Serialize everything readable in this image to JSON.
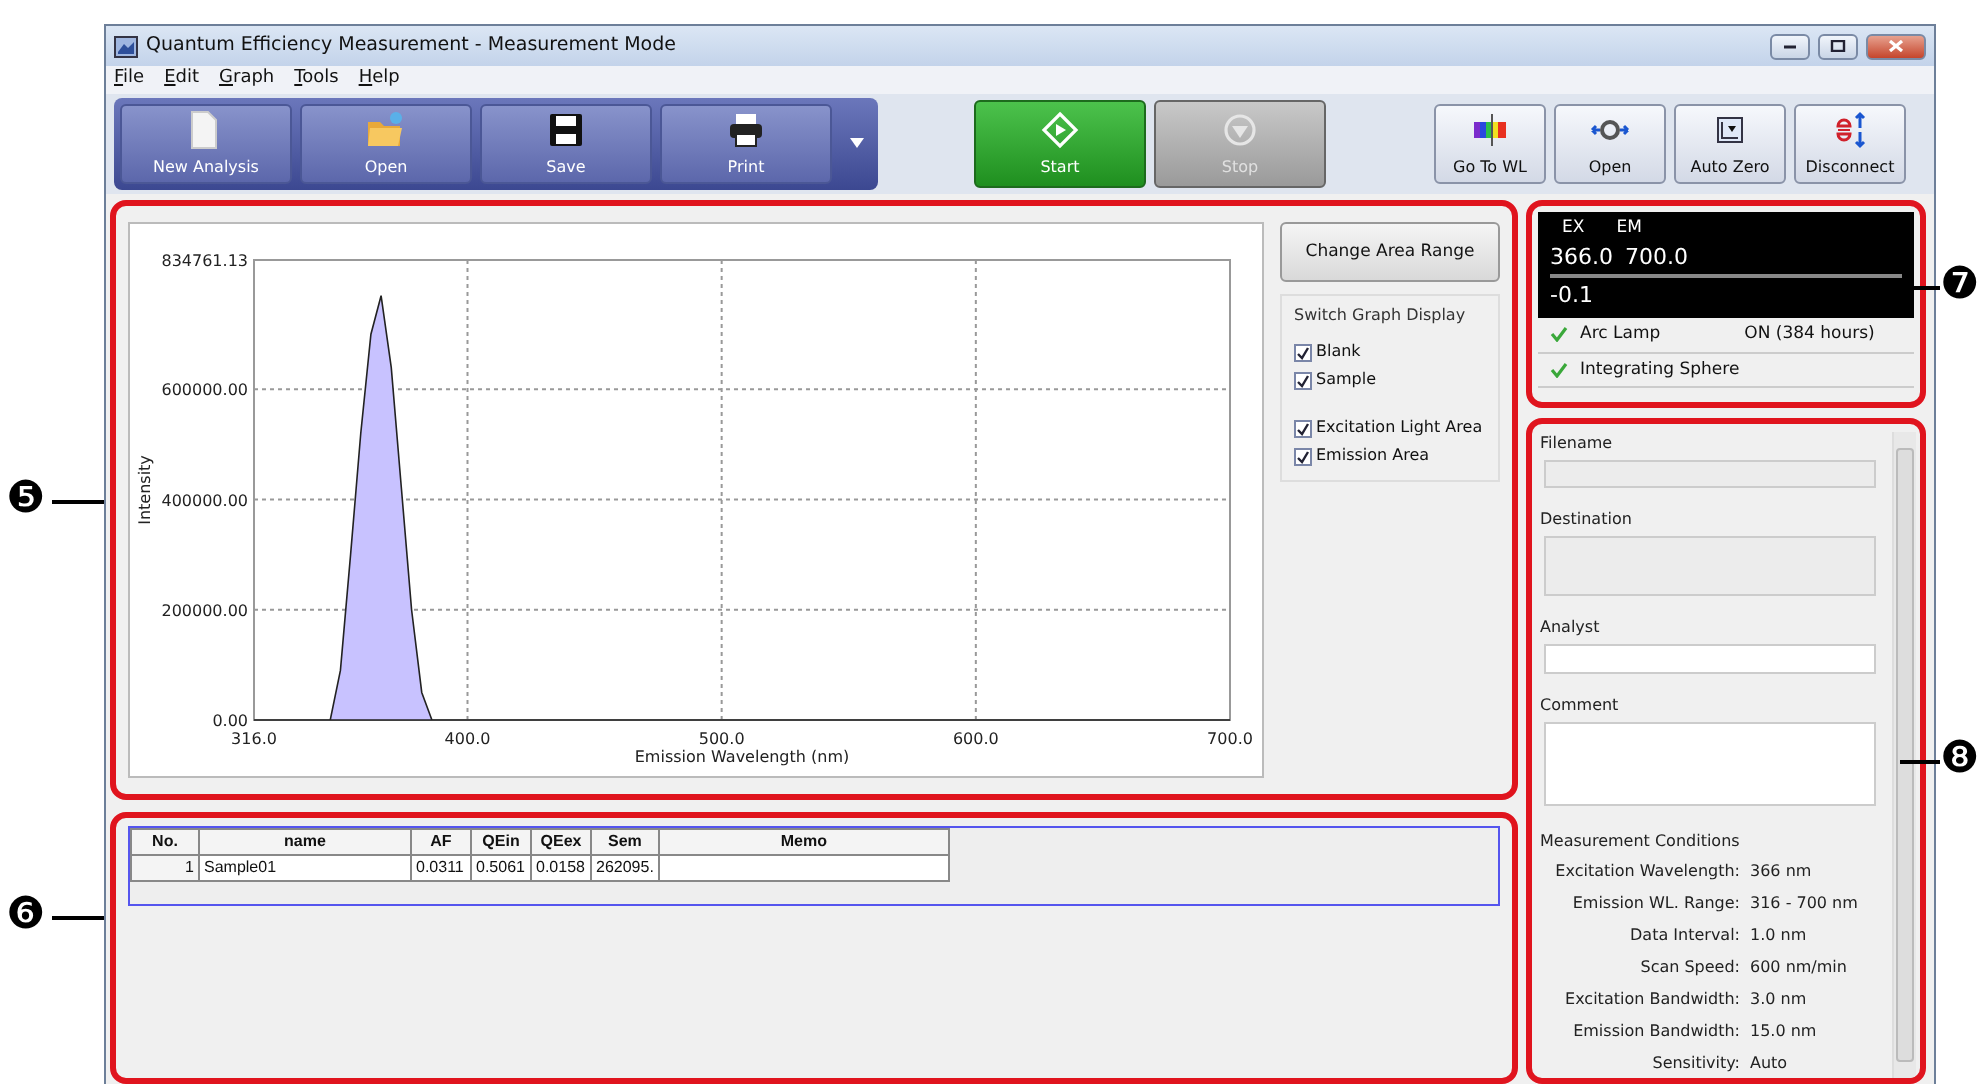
{
  "window": {
    "title": "Quantum Efficiency Measurement - Measurement Mode"
  },
  "menu": [
    "File",
    "Edit",
    "Graph",
    "Tools",
    "Help"
  ],
  "toolbar": {
    "file_buttons": [
      {
        "label": "New Analysis",
        "kind": "document",
        "has_dropdown": false
      },
      {
        "label": "Open",
        "kind": "folder",
        "has_dropdown": false
      },
      {
        "label": "Save",
        "kind": "disk",
        "has_dropdown": false
      },
      {
        "label": "Print",
        "kind": "printer",
        "has_dropdown": true
      }
    ],
    "run_buttons": [
      {
        "label": "Start",
        "kind": "start",
        "disabled": false
      },
      {
        "label": "Stop",
        "kind": "stop",
        "disabled": true
      }
    ],
    "instrument_buttons": [
      {
        "label": "Go To WL",
        "kind": "spectrum"
      },
      {
        "label": "Open",
        "kind": "shutter"
      },
      {
        "label": "Auto Zero",
        "kind": "zero"
      },
      {
        "label": "Disconnect",
        "kind": "disconnect"
      }
    ]
  },
  "graph_panel": {
    "chart_data": {
      "type": "area",
      "xlabel": "Emission Wavelength (nm)",
      "ylabel": "Intensity",
      "x": [
        316,
        346,
        350,
        354,
        358,
        362,
        366,
        370,
        374,
        378,
        382,
        386,
        700
      ],
      "grid": true,
      "series": [
        {
          "color": "#c8c2ff",
          "values": [
            0,
            0,
            90000,
            300000,
            520000,
            700000,
            770000,
            640000,
            420000,
            200000,
            50000,
            0,
            0
          ]
        }
      ],
      "xlim": [
        316,
        700
      ],
      "ylim": [
        0,
        834761.13
      ],
      "xticks": [
        {
          "value": 316,
          "label": "316.0"
        },
        {
          "value": 400,
          "label": "400.0"
        },
        {
          "value": 500,
          "label": "500.0"
        },
        {
          "value": 600,
          "label": "600.0"
        },
        {
          "value": 700,
          "label": "700.0"
        }
      ],
      "yticks": [
        {
          "value": 0,
          "label": "0.00"
        },
        {
          "value": 200000,
          "label": "200000.00"
        },
        {
          "value": 400000,
          "label": "400000.00"
        },
        {
          "value": 600000,
          "label": "600000.00"
        },
        {
          "value": 834761.13,
          "label": "834761.13"
        }
      ]
    },
    "change_area_button": "Change Area Range",
    "display_group": {
      "title": "Switch Graph Display",
      "groups": [
        [
          {
            "label": "Blank",
            "checked": true
          },
          {
            "label": "Sample",
            "checked": true
          }
        ],
        [
          {
            "label": "Excitation Light Area",
            "checked": true
          },
          {
            "label": "Emission Area",
            "checked": true
          }
        ]
      ]
    }
  },
  "results_table": {
    "columns": [
      "No.",
      "name",
      "AF",
      "QEin",
      "QEex",
      "Sem",
      "Memo"
    ],
    "rows": [
      [
        "1",
        "Sample01",
        "0.0311",
        "0.5061",
        "0.0158",
        "262095."
      ]
    ]
  },
  "status": {
    "ex_label": "EX",
    "em_label": "EM",
    "ex_value": "366.0",
    "em_value": "700.0",
    "reading": "-0.1",
    "items": [
      {
        "label": "Arc Lamp",
        "value": "ON (384 hours)",
        "ok": true
      },
      {
        "label": "Integrating Sphere",
        "ok": true
      }
    ]
  },
  "sample_form": {
    "fields": [
      {
        "label": "Filename",
        "kind": "line",
        "disabled": true
      },
      {
        "label": "Destination",
        "kind": "area",
        "disabled": true
      },
      {
        "label": "Analyst",
        "kind": "line",
        "disabled": false
      },
      {
        "label": "Comment",
        "kind": "area",
        "disabled": false
      }
    ],
    "conditions_title": "Measurement Conditions",
    "conditions": [
      {
        "label": "Excitation Wavelength:",
        "value": "366 nm"
      },
      {
        "label": "Emission WL. Range:",
        "value": "316 - 700 nm"
      },
      {
        "label": "Data Interval:",
        "value": "1.0 nm"
      },
      {
        "label": "Scan Speed:",
        "value": "600 nm/min"
      },
      {
        "label": "Excitation Bandwidth:",
        "value": "3.0 nm"
      },
      {
        "label": "Emission Bandwidth:",
        "value": "15.0 nm"
      },
      {
        "label": "Sensitivity:",
        "value": "Auto"
      }
    ]
  },
  "callouts": [
    {
      "number": "❺"
    },
    {
      "number": "❻"
    },
    {
      "number": "❼"
    },
    {
      "number": "❽"
    }
  ]
}
